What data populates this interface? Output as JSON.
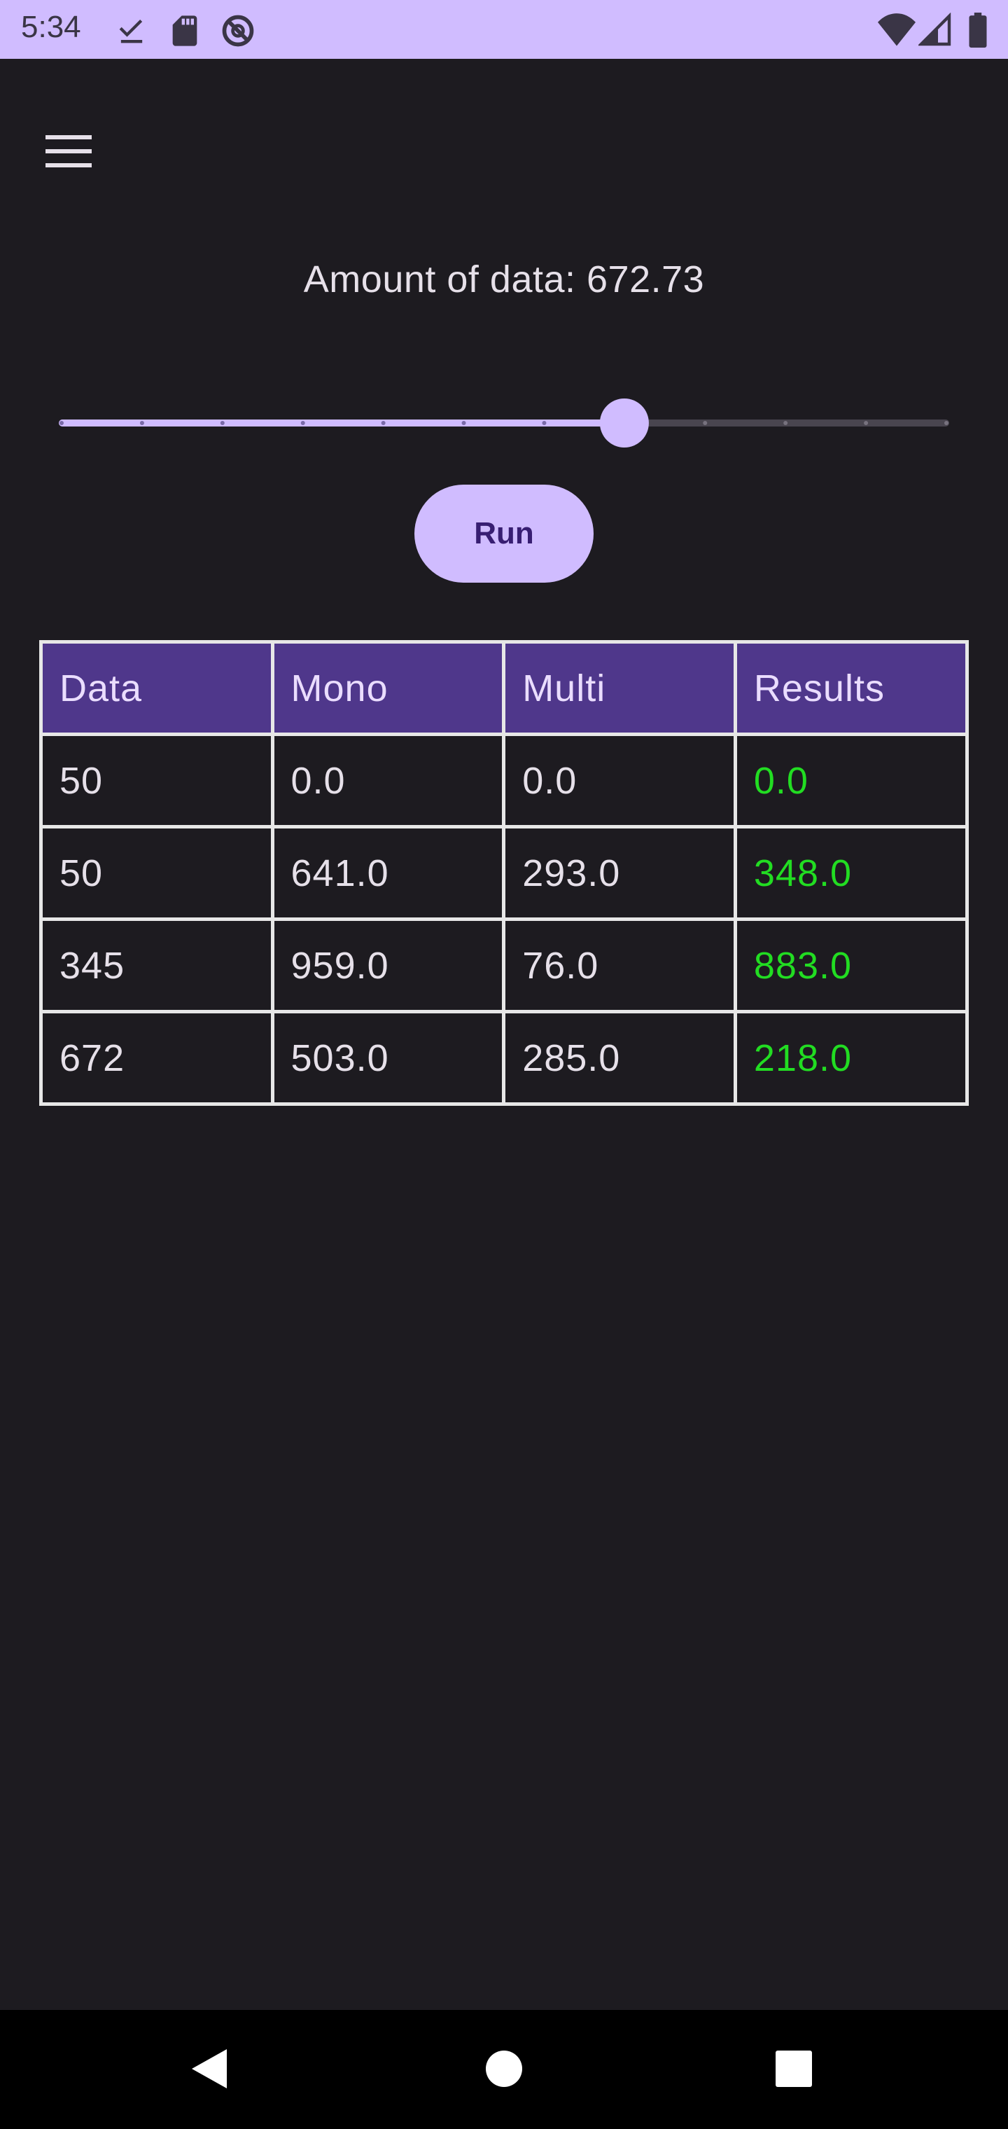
{
  "status_bar": {
    "time": "5:34",
    "left_icons": [
      "download-done-icon",
      "sd-card-icon",
      "do-not-disturb-icon"
    ],
    "right_icons": [
      "wifi-icon",
      "cell-signal-icon",
      "battery-icon"
    ],
    "background": "#d0bcff"
  },
  "app": {
    "menu_icon": "hamburger-menu-icon",
    "amount_label": "Amount of data: 672.73",
    "slider": {
      "value_fraction": 0.636,
      "steps": 11,
      "active_color": "#d0bcff",
      "inactive_color": "#49454f"
    },
    "run_label": "Run"
  },
  "table": {
    "headers": [
      "Data",
      "Mono",
      "Multi",
      "Results"
    ],
    "rows": [
      [
        "50",
        "0.0",
        "0.0",
        "0.0"
      ],
      [
        "50",
        "641.0",
        "293.0",
        "348.0"
      ],
      [
        "345",
        "959.0",
        "76.0",
        "883.0"
      ],
      [
        "672",
        "503.0",
        "285.0",
        "218.0"
      ]
    ],
    "header_color": "#4f378b",
    "result_color": "#22dd22"
  },
  "nav_bar": {
    "icons": [
      "back-icon",
      "home-icon",
      "recents-icon"
    ]
  }
}
